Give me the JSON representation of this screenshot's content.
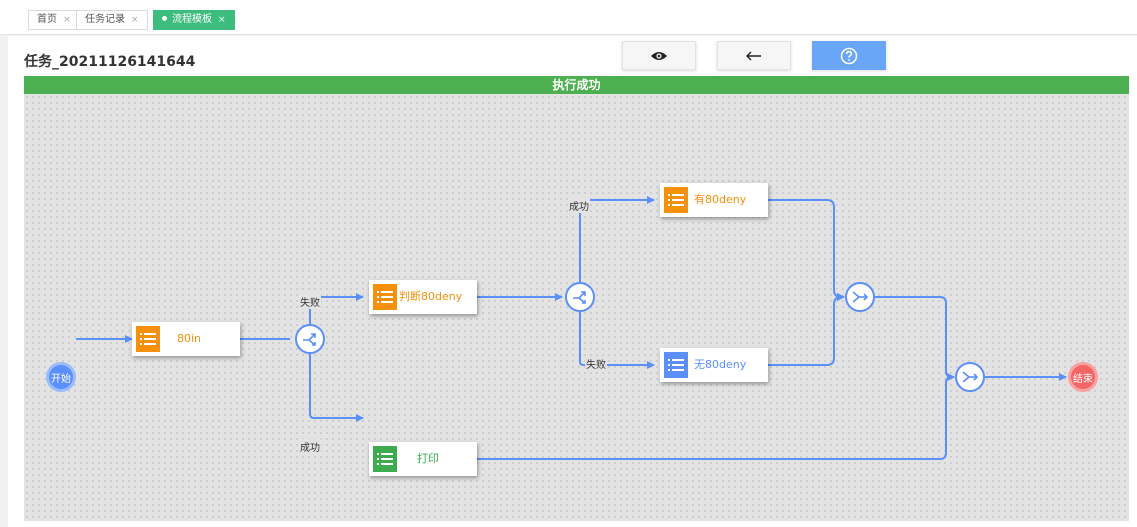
{
  "tabs": [
    {
      "label": "首页",
      "active": false
    },
    {
      "label": "任务记录",
      "active": false
    },
    {
      "label": "流程模板",
      "active": true
    }
  ],
  "page": {
    "title": "任务_20211126141644"
  },
  "toolbar": {
    "view": "eye-icon",
    "back": "arrow-left-icon",
    "help": "question-circle-icon"
  },
  "status": {
    "text": "执行成功",
    "color": "#4caf50"
  },
  "flow": {
    "start_label": "开始",
    "end_label": "结束",
    "nodes": {
      "n80in": {
        "label": "80in",
        "color": "#f5900c"
      },
      "judge": {
        "label": "判断80deny",
        "color": "#f5900c"
      },
      "has": {
        "label": "有80deny",
        "color": "#f5900c"
      },
      "none": {
        "label": "无80deny",
        "color": "#5b8ff9"
      },
      "print": {
        "label": "打印",
        "color": "#3dab4e"
      }
    },
    "edge_labels": {
      "fail1": "失败",
      "success1": "成功",
      "success2": "成功",
      "fail2": "失败"
    },
    "edge_color": "#5b8ff9"
  }
}
